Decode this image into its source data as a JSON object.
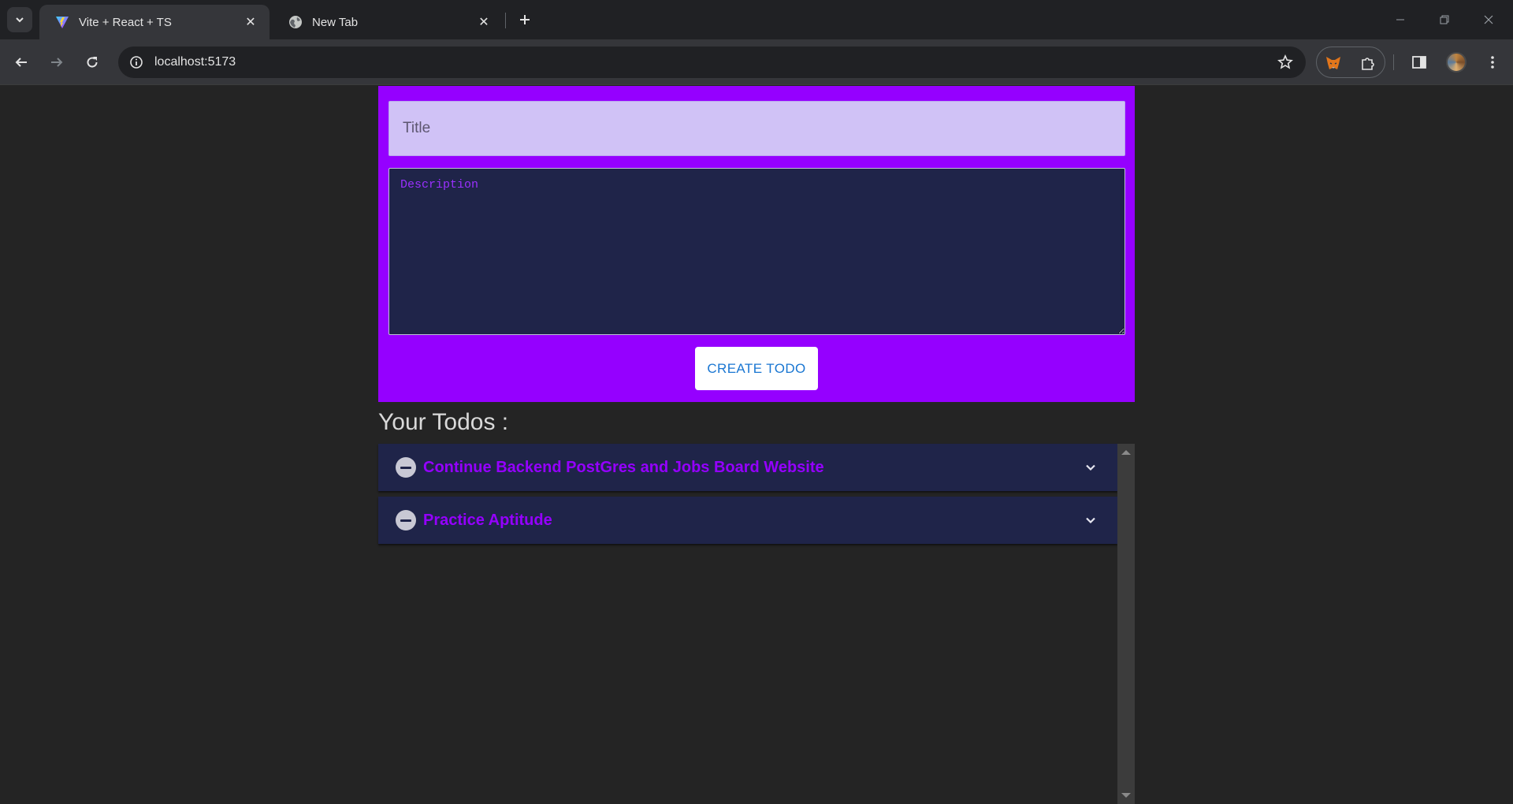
{
  "browser": {
    "tabs": [
      {
        "title": "Vite + React + TS",
        "favicon": "vite-icon",
        "active": true
      },
      {
        "title": "New Tab",
        "favicon": "globe-icon",
        "active": false
      }
    ],
    "url": "localhost:5173",
    "extensions": [
      "metamask-fox-icon",
      "puzzle-extensions-icon"
    ]
  },
  "form": {
    "title_placeholder": "Title",
    "description_placeholder": "Description",
    "create_button_label": "CREATE TODO"
  },
  "todos_heading": "Your Todos :",
  "todos": [
    {
      "title": "Continue Backend PostGres and Jobs Board Website"
    },
    {
      "title": "Practice Aptitude"
    }
  ],
  "colors": {
    "panel": "#9500ff",
    "todo_card": "#1f2449",
    "todo_title": "#9500ff",
    "page_background": "#242424",
    "button_text": "#1976d2"
  }
}
